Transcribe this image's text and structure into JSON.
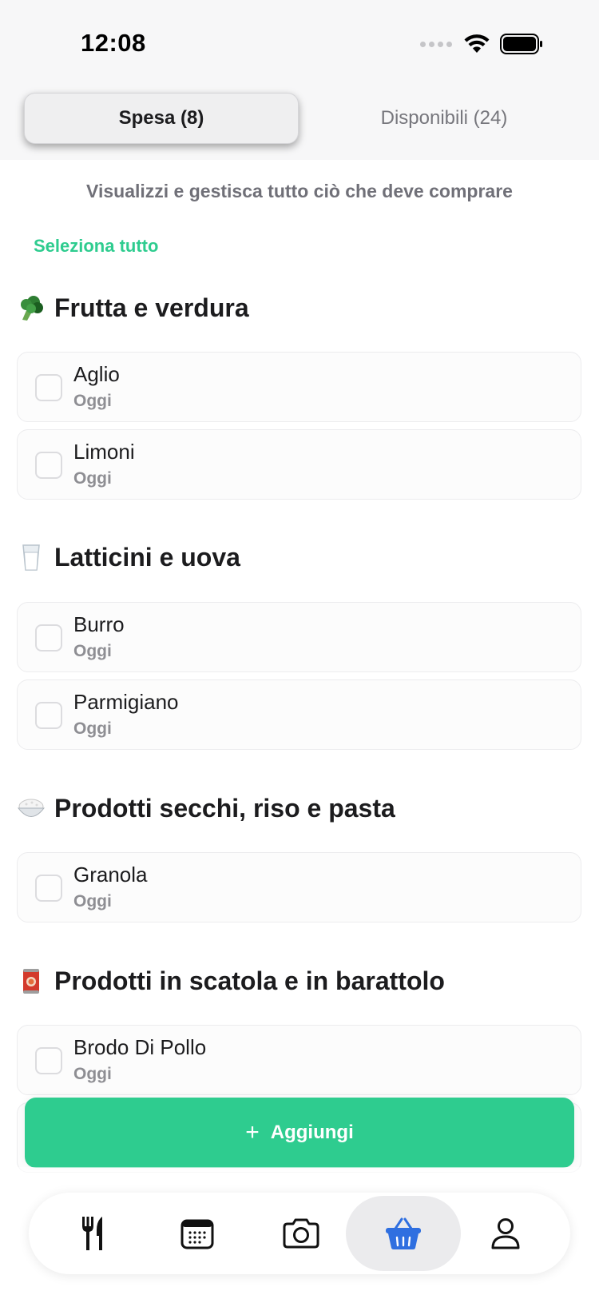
{
  "status_bar": {
    "time": "12:08"
  },
  "segmented": {
    "active_label": "Spesa (8)",
    "inactive_label": "Disponibili (24)"
  },
  "subtitle": "Visualizzi e gestisca tutto ciò che deve comprare",
  "select_all": "Seleziona tutto",
  "categories": [
    {
      "title": "Frutta e verdura",
      "icon": "broccoli-icon",
      "items": [
        {
          "name": "Aglio",
          "when": "Oggi"
        },
        {
          "name": "Limoni",
          "when": "Oggi"
        }
      ]
    },
    {
      "title": "Latticini e uova",
      "icon": "milk-glass-icon",
      "items": [
        {
          "name": "Burro",
          "when": "Oggi"
        },
        {
          "name": "Parmigiano",
          "when": "Oggi"
        }
      ]
    },
    {
      "title": "Prodotti secchi, riso e pasta",
      "icon": "rice-bowl-icon",
      "items": [
        {
          "name": "Granola",
          "when": "Oggi"
        }
      ]
    },
    {
      "title": "Prodotti in scatola e in barattolo",
      "icon": "tin-can-icon",
      "items": [
        {
          "name": "Brodo Di Pollo",
          "when": "Oggi"
        }
      ]
    }
  ],
  "add_button": {
    "label": "Aggiungi",
    "icon": "plus-icon"
  },
  "tab_bar": [
    {
      "name": "recipes",
      "icon": "fork-knife-icon"
    },
    {
      "name": "calendar",
      "icon": "calendar-icon"
    },
    {
      "name": "camera",
      "icon": "camera-icon"
    },
    {
      "name": "shopping",
      "icon": "basket-icon",
      "active": true
    },
    {
      "name": "profile",
      "icon": "person-icon"
    }
  ],
  "colors": {
    "accent": "#2ecc8f",
    "active_tab_icon": "#2f6fe0",
    "text": "#1c1c1e",
    "muted": "#8e8e93"
  }
}
